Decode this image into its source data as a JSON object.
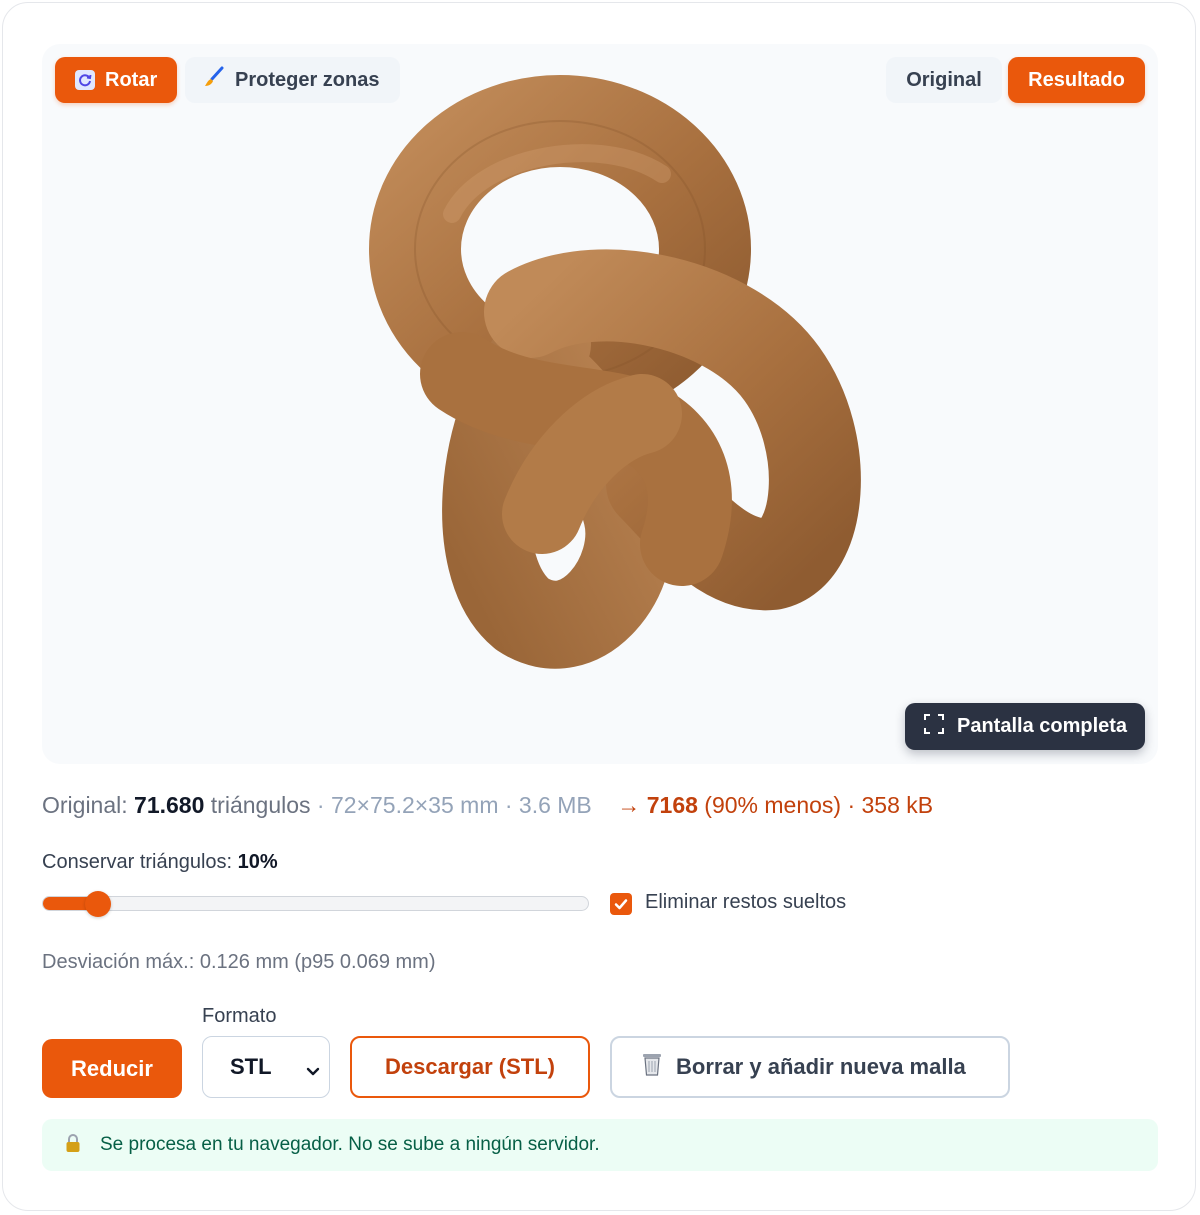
{
  "toolbar": {
    "rotate_label": "Rotar",
    "protect_label": "Proteger zonas",
    "original_label": "Original",
    "result_label": "Resultado",
    "fullscreen_label": "Pantalla completa"
  },
  "viewer": {
    "model_color": "#b07a4a",
    "background": "#f8fafc"
  },
  "stats": {
    "original_prefix": "Original:",
    "original_triangles": "71.680",
    "triangles_word": "triángulos",
    "dims": "· 72×75.2×35 mm · 3.6 MB",
    "arrow": "→",
    "result_triangles": "7168",
    "result_suffix": "(90% menos) · 358 kB"
  },
  "slider": {
    "label": "Conservar triángulos:",
    "value_label": "10%",
    "fraction": 0.1
  },
  "cleanup": {
    "checked": true,
    "label": "Eliminar restos sueltos"
  },
  "deviation": "Desviación máx.: 0.126 mm (p95 0.069 mm)",
  "actions": {
    "format_label": "Formato",
    "format_value": "STL",
    "reduce_label": "Reducir",
    "download_label": "Descargar (STL)",
    "clear_label": "Borrar y añadir nueva malla"
  },
  "notice": "Se procesa en tu navegador. No se sube a ningún servidor.",
  "colors": {
    "accent": "#ea580c",
    "accent_text": "#c2410c",
    "dark_button": "#2b3242",
    "notice_bg": "#ecfdf5",
    "notice_text": "#065f46"
  },
  "icons": {
    "rotate": "rotate-icon",
    "protect": "brush-icon",
    "fullscreen": "fullscreen-icon",
    "clear": "trash-icon",
    "notice": "lock-icon",
    "select": "chevron-down-icon",
    "checkbox": "checkmark-icon"
  }
}
